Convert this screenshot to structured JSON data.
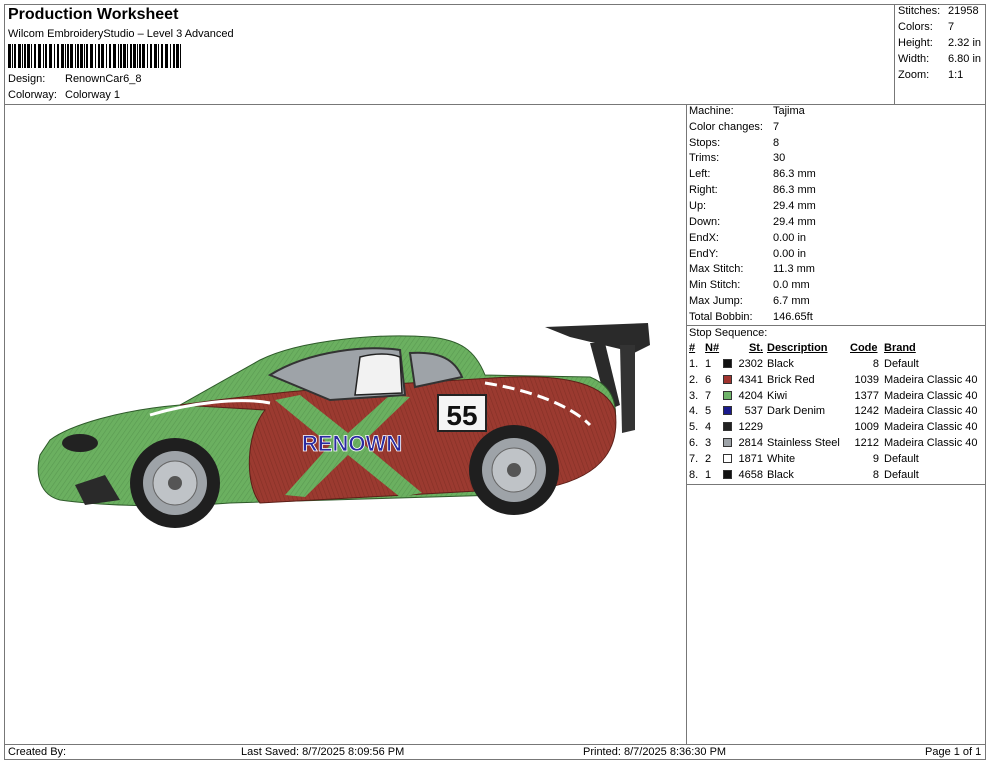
{
  "header": {
    "title": "Production Worksheet",
    "software": "Wilcom EmbroideryStudio – Level 3 Advanced",
    "design_label": "Design:",
    "design_value": "RenownCar6_8",
    "colorway_label": "Colorway:",
    "colorway_value": "Colorway 1"
  },
  "summary": [
    {
      "label": "Stitches:",
      "value": "21958"
    },
    {
      "label": "Colors:",
      "value": "7"
    },
    {
      "label": "Height:",
      "value": "2.32 in"
    },
    {
      "label": "Width:",
      "value": "6.80 in"
    },
    {
      "label": "Zoom:",
      "value": "1:1"
    }
  ],
  "machine_info": [
    {
      "label": "Machine:",
      "value": "Tajima"
    },
    {
      "label": "Color changes:",
      "value": "7"
    },
    {
      "label": "Stops:",
      "value": "8"
    },
    {
      "label": "Trims:",
      "value": "30"
    },
    {
      "label": "Left:",
      "value": "86.3 mm"
    },
    {
      "label": "Right:",
      "value": "86.3 mm"
    },
    {
      "label": "Up:",
      "value": "29.4 mm"
    },
    {
      "label": "Down:",
      "value": "29.4 mm"
    },
    {
      "label": "EndX:",
      "value": "0.00 in"
    },
    {
      "label": "EndY:",
      "value": "0.00 in"
    },
    {
      "label": "Max Stitch:",
      "value": "11.3 mm"
    },
    {
      "label": "Min Stitch:",
      "value": "0.0 mm"
    },
    {
      "label": "Max Jump:",
      "value": "6.7 mm"
    },
    {
      "label": "Total Bobbin:",
      "value": "146.65ft"
    }
  ],
  "stop_sequence": {
    "title": "Stop Sequence:",
    "headers": {
      "num": "#",
      "n": "N#",
      "st": "St.",
      "description": "Description",
      "code": "Code",
      "brand": "Brand"
    },
    "rows": [
      {
        "num": "1.",
        "n": "1",
        "color": "#111111",
        "st": "2302",
        "description": "Black",
        "code": "8",
        "brand": "Default"
      },
      {
        "num": "2.",
        "n": "6",
        "color": "#a0342f",
        "st": "4341",
        "description": "Brick Red",
        "code": "1039",
        "brand": "Madeira Classic 40"
      },
      {
        "num": "3.",
        "n": "7",
        "color": "#6fb46a",
        "st": "4204",
        "description": "Kiwi",
        "code": "1377",
        "brand": "Madeira Classic 40"
      },
      {
        "num": "4.",
        "n": "5",
        "color": "#1a1a8c",
        "st": "537",
        "description": "Dark Denim",
        "code": "1242",
        "brand": "Madeira Classic 40"
      },
      {
        "num": "5.",
        "n": "4",
        "color": "#222222",
        "st": "1229",
        "description": "",
        "code": "1009",
        "brand": "Madeira Classic 40"
      },
      {
        "num": "6.",
        "n": "3",
        "color": "#9ea3a8",
        "st": "2814",
        "description": "Stainless Steel",
        "code": "1212",
        "brand": "Madeira Classic 40"
      },
      {
        "num": "7.",
        "n": "2",
        "color": "#ffffff",
        "st": "1871",
        "description": "White",
        "code": "9",
        "brand": "Default"
      },
      {
        "num": "8.",
        "n": "1",
        "color": "#111111",
        "st": "4658",
        "description": "Black",
        "code": "8",
        "brand": "Default"
      }
    ]
  },
  "car": {
    "number": "55",
    "logo_text": "RENOWN",
    "colors": {
      "green": "#6bb060",
      "red": "#9b3a30",
      "dark": "#1f1f1f",
      "steel": "#9ea3a8",
      "blue": "#2a2aa0"
    }
  },
  "footer": {
    "created_by": "Created By:",
    "last_saved": "Last Saved: 8/7/2025 8:09:56 PM",
    "printed": "Printed: 8/7/2025 8:36:30 PM",
    "page": "Page 1 of 1"
  }
}
